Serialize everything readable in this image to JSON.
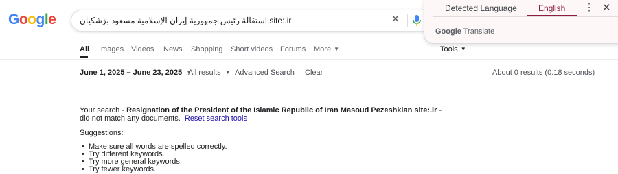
{
  "logo": {
    "letters": [
      "G",
      "o",
      "o",
      "g",
      "l",
      "e"
    ],
    "colors": [
      "#4285f4",
      "#ea4335",
      "#fbbc05",
      "#4285f4",
      "#34a853",
      "#ea4335"
    ]
  },
  "search": {
    "query": "استقالة رئيس جمهورية إيران الإسلامية مسعود بزشكيان site:.ir"
  },
  "tabs": [
    {
      "label": "All"
    },
    {
      "label": "Images"
    },
    {
      "label": "Videos"
    },
    {
      "label": "News"
    },
    {
      "label": "Shopping"
    },
    {
      "label": "Short videos"
    },
    {
      "label": "Forums"
    },
    {
      "label": "More"
    },
    {
      "label": "Tools"
    }
  ],
  "tools": {
    "date_range": "June 1, 2025 – June 23, 2025",
    "results_filter": "All results",
    "advanced": "Advanced Search",
    "clear": "Clear",
    "stats": "About 0 results (0.18 seconds)"
  },
  "no_results": {
    "prefix": "Your search - ",
    "query": "Resignation of the President of the Islamic Republic of Iran Masoud Pezeshkian site:.ir",
    "suffix": " -",
    "line2": "did not match any documents.",
    "reset_link": "Reset search tools",
    "suggestions_title": "Suggestions:",
    "suggestions": [
      "Make sure all words are spelled correctly.",
      "Try different keywords.",
      "Try more general keywords.",
      "Try fewer keywords."
    ]
  },
  "translate": {
    "detected_tab": "Detected Language",
    "english_tab": "English",
    "brand_google": "Google",
    "brand_translate": "Translate"
  }
}
